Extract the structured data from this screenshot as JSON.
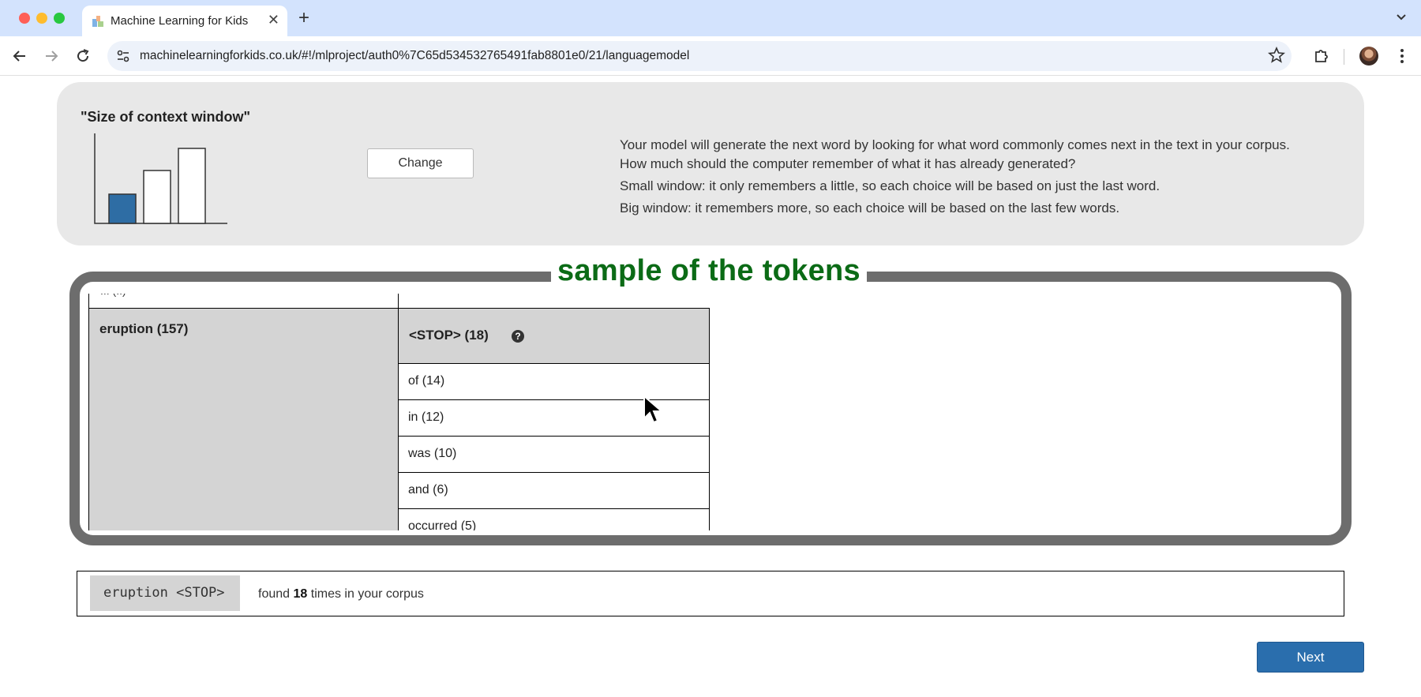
{
  "browser": {
    "tab_title": "Machine Learning for Kids",
    "url": "machinelearningforkids.co.uk/#!/mlproject/auth0%7C65d534532765491fab8801e0/21/languagemodel"
  },
  "context_panel": {
    "title": "\"Size of context window\"",
    "change_label": "Change",
    "window_levels": [
      1,
      2,
      3
    ],
    "selected_level": 1,
    "selected_color": "#2e6da4",
    "description": [
      "Your model will generate the next word by looking for what word commonly comes next in the text in your corpus.",
      "How much should the computer remember of what it has already generated?",
      "Small window: it only remembers a little, so each choice will be based on just the last word.",
      "Big window: it remembers more, so each choice will be based on the last few words."
    ]
  },
  "tokens": {
    "heading": "sample of the tokens",
    "heading_color": "#0b6b16",
    "previous_partial": "... (..)",
    "root": "eruption (157)",
    "next_header": "<STOP> (18)",
    "help_icon": "?",
    "next_items": [
      "of (14)",
      "in (12)",
      "was (10)",
      "and (6)",
      "occurred (5)"
    ]
  },
  "selection": {
    "sequence": "eruption <STOP>",
    "found_prefix": "found",
    "found_count": "18",
    "found_suffix": "times in your corpus"
  },
  "next_button": "Next"
}
